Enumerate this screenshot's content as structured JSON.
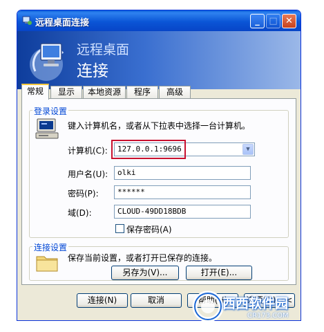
{
  "window": {
    "title": "远程桌面连接"
  },
  "titlebar_buttons": {
    "minimize": "_",
    "maximize": "□",
    "close": "✕"
  },
  "banner": {
    "line1": "远程桌面",
    "line2": "连接"
  },
  "tabs": [
    {
      "label": "常规",
      "active": true
    },
    {
      "label": "显示"
    },
    {
      "label": "本地资源"
    },
    {
      "label": "程序"
    },
    {
      "label": "高级"
    }
  ],
  "login": {
    "title": "登录设置",
    "instruction": "键入计算机名，或者从下拉表中选择一台计算机。",
    "computer_label": "计算机(C):",
    "computer_value": "127.0.0.1:9696",
    "username_label": "用户名(U):",
    "username_value": "olki",
    "password_label": "密码(P):",
    "password_value": "******",
    "domain_label": "域(D):",
    "domain_value": "CLOUD-49DD18BDB",
    "save_password_label": "保存密码(A)",
    "save_password_checked": false
  },
  "connection": {
    "title": "连接设置",
    "instruction": "保存当前设置，或者打开已保存的连接。",
    "save_as_label": "另存为(V)...",
    "open_label": "打开(E)..."
  },
  "footer": {
    "connect_label": "连接(N)",
    "cancel_label": "取消",
    "help_label": "帮助(H)",
    "options_label": "选项(O) <<"
  },
  "watermark": {
    "text": "西西软件园",
    "sub": "CR173.COM"
  },
  "colors": {
    "titlebar": "#0a55d6",
    "accent": "#0046d5",
    "highlight": "#c8102e",
    "window_bg": "#ece9d8"
  }
}
